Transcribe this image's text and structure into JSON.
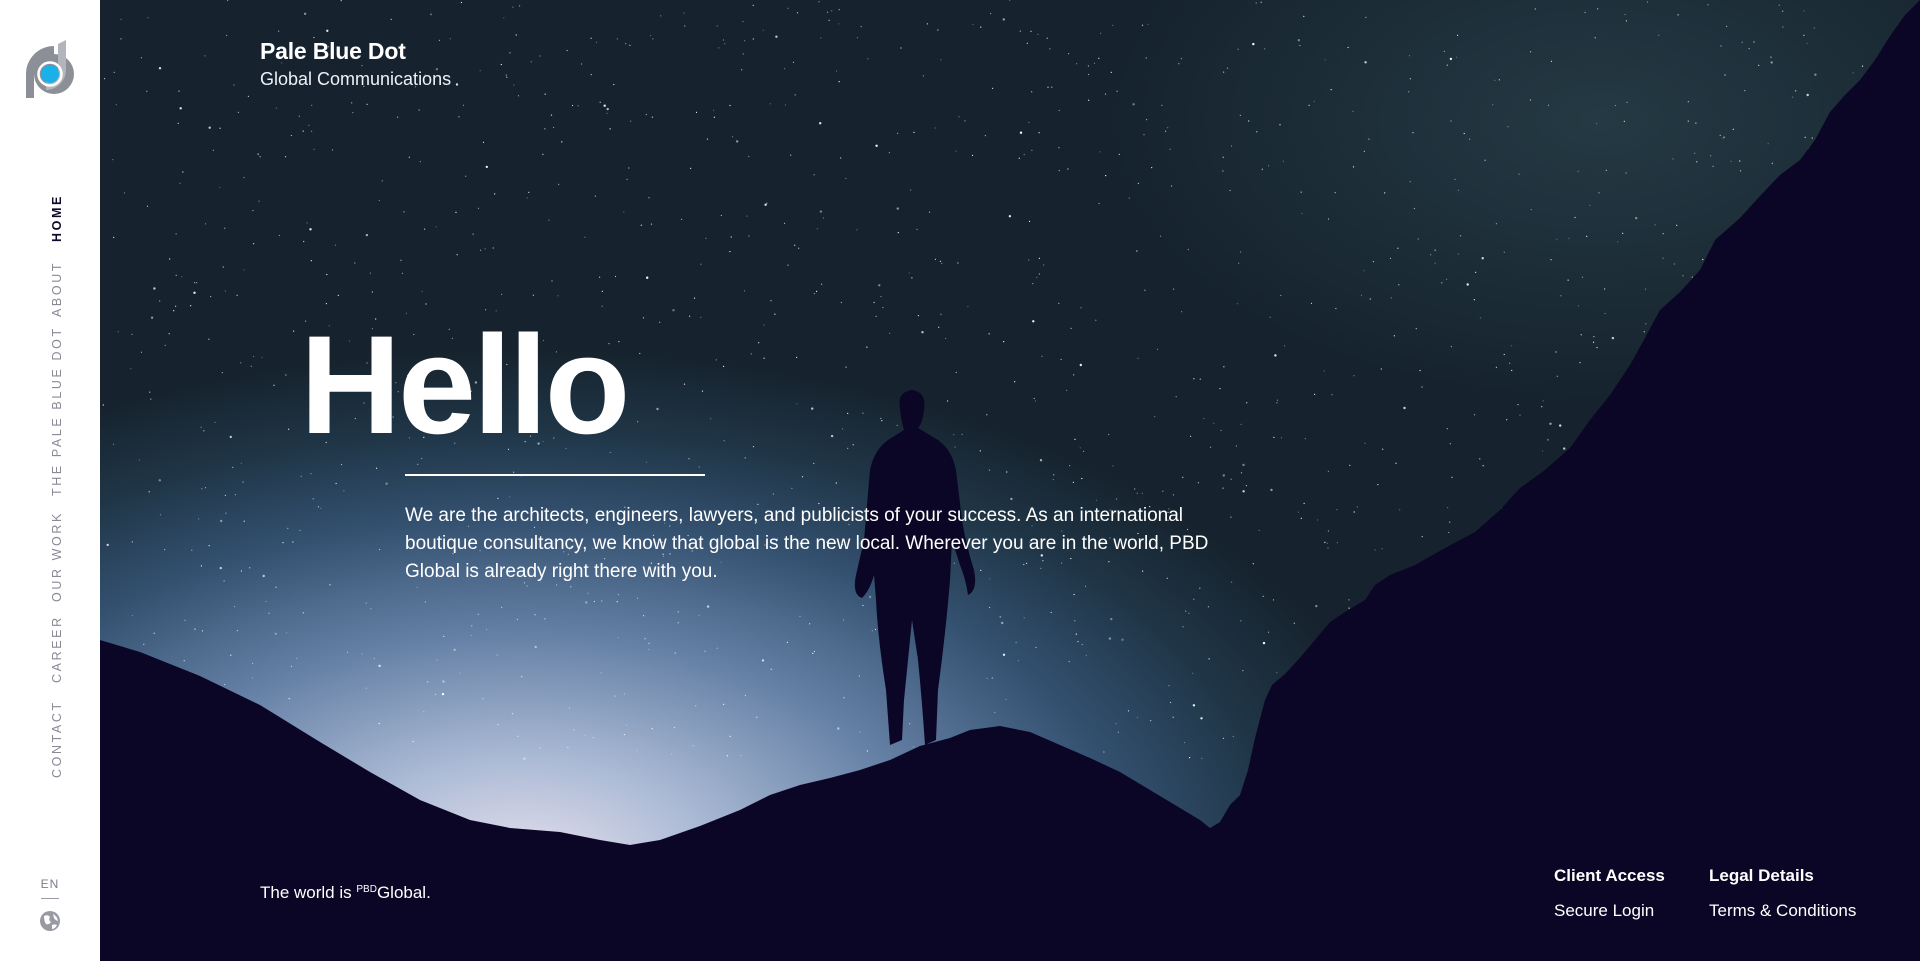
{
  "brand": {
    "name": "Pale Blue Dot",
    "subtitle": "Global Communications"
  },
  "nav": {
    "items": [
      {
        "label": "HOME",
        "active": true
      },
      {
        "label": "ABOUT",
        "active": false
      },
      {
        "label": "THE PALE BLUE DOT",
        "active": false
      },
      {
        "label": "OUR WORK",
        "active": false
      },
      {
        "label": "CAREER",
        "active": false
      },
      {
        "label": "CONTACT",
        "active": false
      }
    ],
    "language": "EN",
    "globe_icon": "globe-icon"
  },
  "hero": {
    "heading": "Hello",
    "intro": "We are the architects, engineers, lawyers, and publicists of your success. As an international boutique consultancy, we know that global is the new local. Wherever you are in the world, PBD Global is already right there with you."
  },
  "tagline": {
    "prefix": "The world is ",
    "superscript": "PBD",
    "suffix": "Global."
  },
  "footer": {
    "client_access": {
      "heading": "Client Access",
      "link": "Secure Login"
    },
    "legal": {
      "heading": "Legal Details",
      "link": "Terms & Conditions"
    }
  },
  "colors": {
    "accent": "#1ab0e8",
    "logo_gray": "#8d8f97",
    "mountain": "#0c0626"
  }
}
